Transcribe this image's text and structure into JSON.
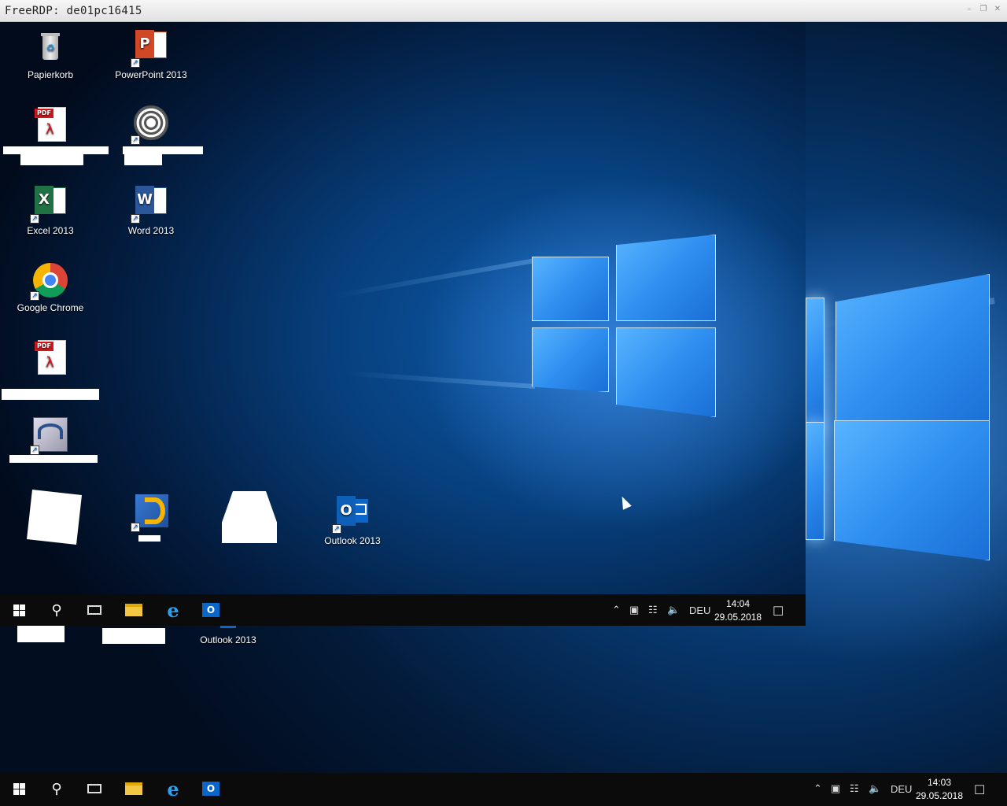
{
  "window": {
    "title": "FreeRDP: de01pc16415"
  },
  "remote": {
    "icons": [
      {
        "label": "Papierkorb",
        "icon": "recycle-bin-icon"
      },
      {
        "label": "PowerPoint 2013",
        "icon": "powerpoint-icon",
        "badge": "P"
      },
      {
        "label": "",
        "icon": "pdf-document-icon",
        "badge": "PDF"
      },
      {
        "label": "",
        "icon": "spiral-app-icon"
      },
      {
        "label": "Excel 2013",
        "icon": "excel-icon",
        "badge": "X"
      },
      {
        "label": "Word 2013",
        "icon": "word-icon",
        "badge": "W"
      },
      {
        "label": "Google Chrome",
        "icon": "chrome-icon"
      },
      {
        "label": "",
        "icon": "pdf-document-icon",
        "badge": "PDF"
      },
      {
        "label": "",
        "icon": "remote-app-icon"
      },
      {
        "label": "Outlook 2013",
        "icon": "outlook-icon",
        "badge": "O"
      }
    ],
    "taskbar": {
      "language": "DEU",
      "time": "14:04",
      "date": "29.05.2018"
    }
  },
  "local": {
    "icons": [
      {
        "label": "Outlook 2013",
        "icon": "outlook-icon"
      }
    ],
    "taskbar": {
      "language": "DEU",
      "time": "14:03",
      "date": "29.05.2018"
    }
  },
  "colors": {
    "accent": "#0a67c9",
    "taskbar": "#0b0b0b"
  }
}
